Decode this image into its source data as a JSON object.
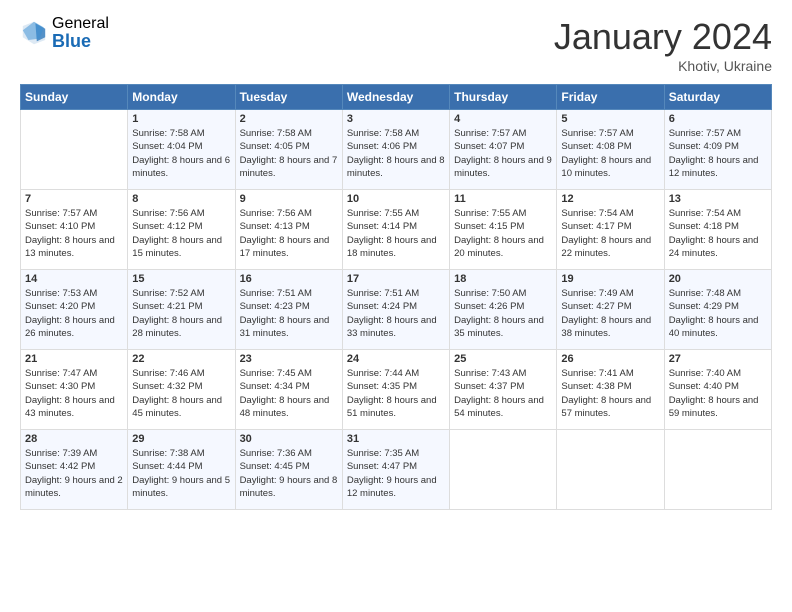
{
  "logo": {
    "general": "General",
    "blue": "Blue"
  },
  "header": {
    "month": "January 2024",
    "location": "Khotiv, Ukraine"
  },
  "weekdays": [
    "Sunday",
    "Monday",
    "Tuesday",
    "Wednesday",
    "Thursday",
    "Friday",
    "Saturday"
  ],
  "weeks": [
    [
      {
        "day": "",
        "sunrise": "",
        "sunset": "",
        "daylight": ""
      },
      {
        "day": "1",
        "sunrise": "Sunrise: 7:58 AM",
        "sunset": "Sunset: 4:04 PM",
        "daylight": "Daylight: 8 hours and 6 minutes."
      },
      {
        "day": "2",
        "sunrise": "Sunrise: 7:58 AM",
        "sunset": "Sunset: 4:05 PM",
        "daylight": "Daylight: 8 hours and 7 minutes."
      },
      {
        "day": "3",
        "sunrise": "Sunrise: 7:58 AM",
        "sunset": "Sunset: 4:06 PM",
        "daylight": "Daylight: 8 hours and 8 minutes."
      },
      {
        "day": "4",
        "sunrise": "Sunrise: 7:57 AM",
        "sunset": "Sunset: 4:07 PM",
        "daylight": "Daylight: 8 hours and 9 minutes."
      },
      {
        "day": "5",
        "sunrise": "Sunrise: 7:57 AM",
        "sunset": "Sunset: 4:08 PM",
        "daylight": "Daylight: 8 hours and 10 minutes."
      },
      {
        "day": "6",
        "sunrise": "Sunrise: 7:57 AM",
        "sunset": "Sunset: 4:09 PM",
        "daylight": "Daylight: 8 hours and 12 minutes."
      }
    ],
    [
      {
        "day": "7",
        "sunrise": "Sunrise: 7:57 AM",
        "sunset": "Sunset: 4:10 PM",
        "daylight": "Daylight: 8 hours and 13 minutes."
      },
      {
        "day": "8",
        "sunrise": "Sunrise: 7:56 AM",
        "sunset": "Sunset: 4:12 PM",
        "daylight": "Daylight: 8 hours and 15 minutes."
      },
      {
        "day": "9",
        "sunrise": "Sunrise: 7:56 AM",
        "sunset": "Sunset: 4:13 PM",
        "daylight": "Daylight: 8 hours and 17 minutes."
      },
      {
        "day": "10",
        "sunrise": "Sunrise: 7:55 AM",
        "sunset": "Sunset: 4:14 PM",
        "daylight": "Daylight: 8 hours and 18 minutes."
      },
      {
        "day": "11",
        "sunrise": "Sunrise: 7:55 AM",
        "sunset": "Sunset: 4:15 PM",
        "daylight": "Daylight: 8 hours and 20 minutes."
      },
      {
        "day": "12",
        "sunrise": "Sunrise: 7:54 AM",
        "sunset": "Sunset: 4:17 PM",
        "daylight": "Daylight: 8 hours and 22 minutes."
      },
      {
        "day": "13",
        "sunrise": "Sunrise: 7:54 AM",
        "sunset": "Sunset: 4:18 PM",
        "daylight": "Daylight: 8 hours and 24 minutes."
      }
    ],
    [
      {
        "day": "14",
        "sunrise": "Sunrise: 7:53 AM",
        "sunset": "Sunset: 4:20 PM",
        "daylight": "Daylight: 8 hours and 26 minutes."
      },
      {
        "day": "15",
        "sunrise": "Sunrise: 7:52 AM",
        "sunset": "Sunset: 4:21 PM",
        "daylight": "Daylight: 8 hours and 28 minutes."
      },
      {
        "day": "16",
        "sunrise": "Sunrise: 7:51 AM",
        "sunset": "Sunset: 4:23 PM",
        "daylight": "Daylight: 8 hours and 31 minutes."
      },
      {
        "day": "17",
        "sunrise": "Sunrise: 7:51 AM",
        "sunset": "Sunset: 4:24 PM",
        "daylight": "Daylight: 8 hours and 33 minutes."
      },
      {
        "day": "18",
        "sunrise": "Sunrise: 7:50 AM",
        "sunset": "Sunset: 4:26 PM",
        "daylight": "Daylight: 8 hours and 35 minutes."
      },
      {
        "day": "19",
        "sunrise": "Sunrise: 7:49 AM",
        "sunset": "Sunset: 4:27 PM",
        "daylight": "Daylight: 8 hours and 38 minutes."
      },
      {
        "day": "20",
        "sunrise": "Sunrise: 7:48 AM",
        "sunset": "Sunset: 4:29 PM",
        "daylight": "Daylight: 8 hours and 40 minutes."
      }
    ],
    [
      {
        "day": "21",
        "sunrise": "Sunrise: 7:47 AM",
        "sunset": "Sunset: 4:30 PM",
        "daylight": "Daylight: 8 hours and 43 minutes."
      },
      {
        "day": "22",
        "sunrise": "Sunrise: 7:46 AM",
        "sunset": "Sunset: 4:32 PM",
        "daylight": "Daylight: 8 hours and 45 minutes."
      },
      {
        "day": "23",
        "sunrise": "Sunrise: 7:45 AM",
        "sunset": "Sunset: 4:34 PM",
        "daylight": "Daylight: 8 hours and 48 minutes."
      },
      {
        "day": "24",
        "sunrise": "Sunrise: 7:44 AM",
        "sunset": "Sunset: 4:35 PM",
        "daylight": "Daylight: 8 hours and 51 minutes."
      },
      {
        "day": "25",
        "sunrise": "Sunrise: 7:43 AM",
        "sunset": "Sunset: 4:37 PM",
        "daylight": "Daylight: 8 hours and 54 minutes."
      },
      {
        "day": "26",
        "sunrise": "Sunrise: 7:41 AM",
        "sunset": "Sunset: 4:38 PM",
        "daylight": "Daylight: 8 hours and 57 minutes."
      },
      {
        "day": "27",
        "sunrise": "Sunrise: 7:40 AM",
        "sunset": "Sunset: 4:40 PM",
        "daylight": "Daylight: 8 hours and 59 minutes."
      }
    ],
    [
      {
        "day": "28",
        "sunrise": "Sunrise: 7:39 AM",
        "sunset": "Sunset: 4:42 PM",
        "daylight": "Daylight: 9 hours and 2 minutes."
      },
      {
        "day": "29",
        "sunrise": "Sunrise: 7:38 AM",
        "sunset": "Sunset: 4:44 PM",
        "daylight": "Daylight: 9 hours and 5 minutes."
      },
      {
        "day": "30",
        "sunrise": "Sunrise: 7:36 AM",
        "sunset": "Sunset: 4:45 PM",
        "daylight": "Daylight: 9 hours and 8 minutes."
      },
      {
        "day": "31",
        "sunrise": "Sunrise: 7:35 AM",
        "sunset": "Sunset: 4:47 PM",
        "daylight": "Daylight: 9 hours and 12 minutes."
      },
      {
        "day": "",
        "sunrise": "",
        "sunset": "",
        "daylight": ""
      },
      {
        "day": "",
        "sunrise": "",
        "sunset": "",
        "daylight": ""
      },
      {
        "day": "",
        "sunrise": "",
        "sunset": "",
        "daylight": ""
      }
    ]
  ]
}
